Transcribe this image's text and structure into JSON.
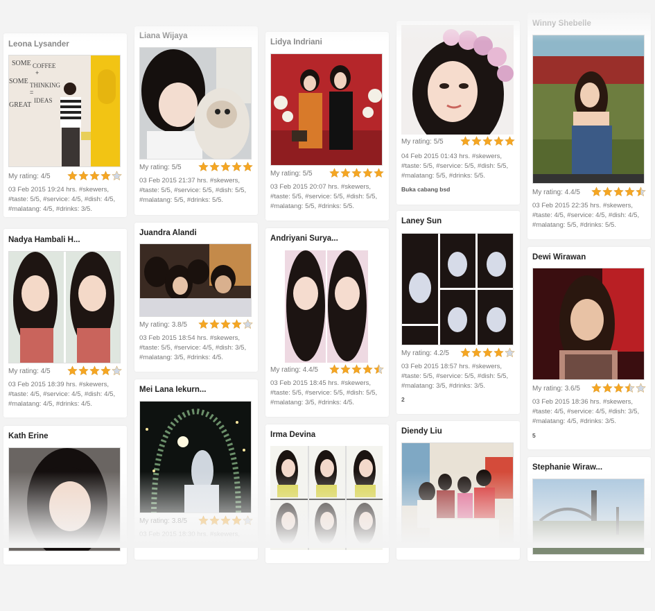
{
  "rating_label_prefix": "My rating: ",
  "colors": {
    "star_filled": "#f5a623",
    "star_empty": "#cfd8e6",
    "card_bg": "#ffffff",
    "page_bg": "#f3f3f3"
  },
  "cards": [
    {
      "name": "Leona Lysander",
      "rating": "4/5",
      "stars": 4,
      "review": "03 Feb 2015 19:24 hrs. #skewers, #taste: 5/5, #service: 4/5, #dish: 4/5, #malatang: 4/5, #drinks: 3/5.",
      "extra": ""
    },
    {
      "name": "Nadya Hambali H...",
      "rating": "4/5",
      "stars": 4,
      "review": "03 Feb 2015 18:39 hrs. #skewers, #taste: 4/5, #service: 4/5, #dish: 4/5, #malatang: 4/5, #drinks: 4/5.",
      "extra": ""
    },
    {
      "name": "Kath Erine",
      "rating": "",
      "stars": 0,
      "review": "",
      "extra": ""
    },
    {
      "name": "Liana Wijaya",
      "rating": "5/5",
      "stars": 5,
      "review": "03 Feb 2015 21:37 hrs. #skewers, #taste: 5/5, #service: 5/5, #dish: 5/5, #malatang: 5/5, #drinks: 5/5.",
      "extra": ""
    },
    {
      "name": "Juandra Alandi",
      "rating": "3.8/5",
      "stars": 4,
      "review": "03 Feb 2015 18:54 hrs. #skewers, #taste: 5/5, #service: 4/5, #dish: 3/5, #malatang: 3/5, #drinks: 4/5.",
      "extra": ""
    },
    {
      "name": "Mei Lana Iekurn...",
      "rating": "3.8/5",
      "stars": 4,
      "review": "03 Feb 2015 18:30 hrs. #skewers,",
      "extra": ""
    },
    {
      "name": "Lidya Indriani",
      "rating": "5/5",
      "stars": 5,
      "review": "03 Feb 2015 20:07 hrs. #skewers, #taste: 5/5, #service: 5/5, #dish: 5/5, #malatang: 5/5, #drinks: 5/5.",
      "extra": ""
    },
    {
      "name": "Andriyani Surya...",
      "rating": "4.4/5",
      "stars": 4.5,
      "review": "03 Feb 2015 18:45 hrs. #skewers, #taste: 5/5, #service: 5/5, #dish: 5/5, #malatang: 3/5, #drinks: 4/5.",
      "extra": ""
    },
    {
      "name": "Irma Devina",
      "rating": "",
      "stars": 0,
      "review": "",
      "extra": ""
    },
    {
      "name": "",
      "rating": "5/5",
      "stars": 5,
      "review": "04 Feb 2015 01:43 hrs. #skewers, #taste: 5/5, #service: 5/5, #dish: 5/5, #malatang: 5/5, #drinks: 5/5.",
      "extra": "Buka cabang bsd"
    },
    {
      "name": "Laney Sun",
      "rating": "4.2/5",
      "stars": 4,
      "review": "03 Feb 2015 18:57 hrs. #skewers, #taste: 5/5, #service: 5/5, #dish: 5/5, #malatang: 3/5, #drinks: 3/5.",
      "extra": "2"
    },
    {
      "name": "Diendy Liu",
      "rating": "",
      "stars": 0,
      "review": "",
      "extra": ""
    },
    {
      "name": "Winny Shebelle",
      "rating": "4.4/5",
      "stars": 4.5,
      "review": "03 Feb 2015 22:35 hrs. #skewers, #taste: 4/5, #service: 4/5, #dish: 4/5, #malatang: 5/5, #drinks: 5/5.",
      "extra": ""
    },
    {
      "name": "Dewi Wirawan",
      "rating": "3.6/5",
      "stars": 3.5,
      "review": "03 Feb 2015 18:36 hrs. #skewers, #taste: 4/5, #service: 4/5, #dish: 3/5, #malatang: 4/5, #drinks: 3/5.",
      "extra": "5"
    },
    {
      "name": "Stephanie Wiraw...",
      "rating": "",
      "stars": 0,
      "review": "",
      "extra": ""
    }
  ],
  "photo_texts": {
    "coffee_wall": [
      "SOME",
      "COFFEE",
      "+",
      "SOME",
      "THINKING",
      "=",
      "GREAT",
      "IDEAS"
    ]
  }
}
